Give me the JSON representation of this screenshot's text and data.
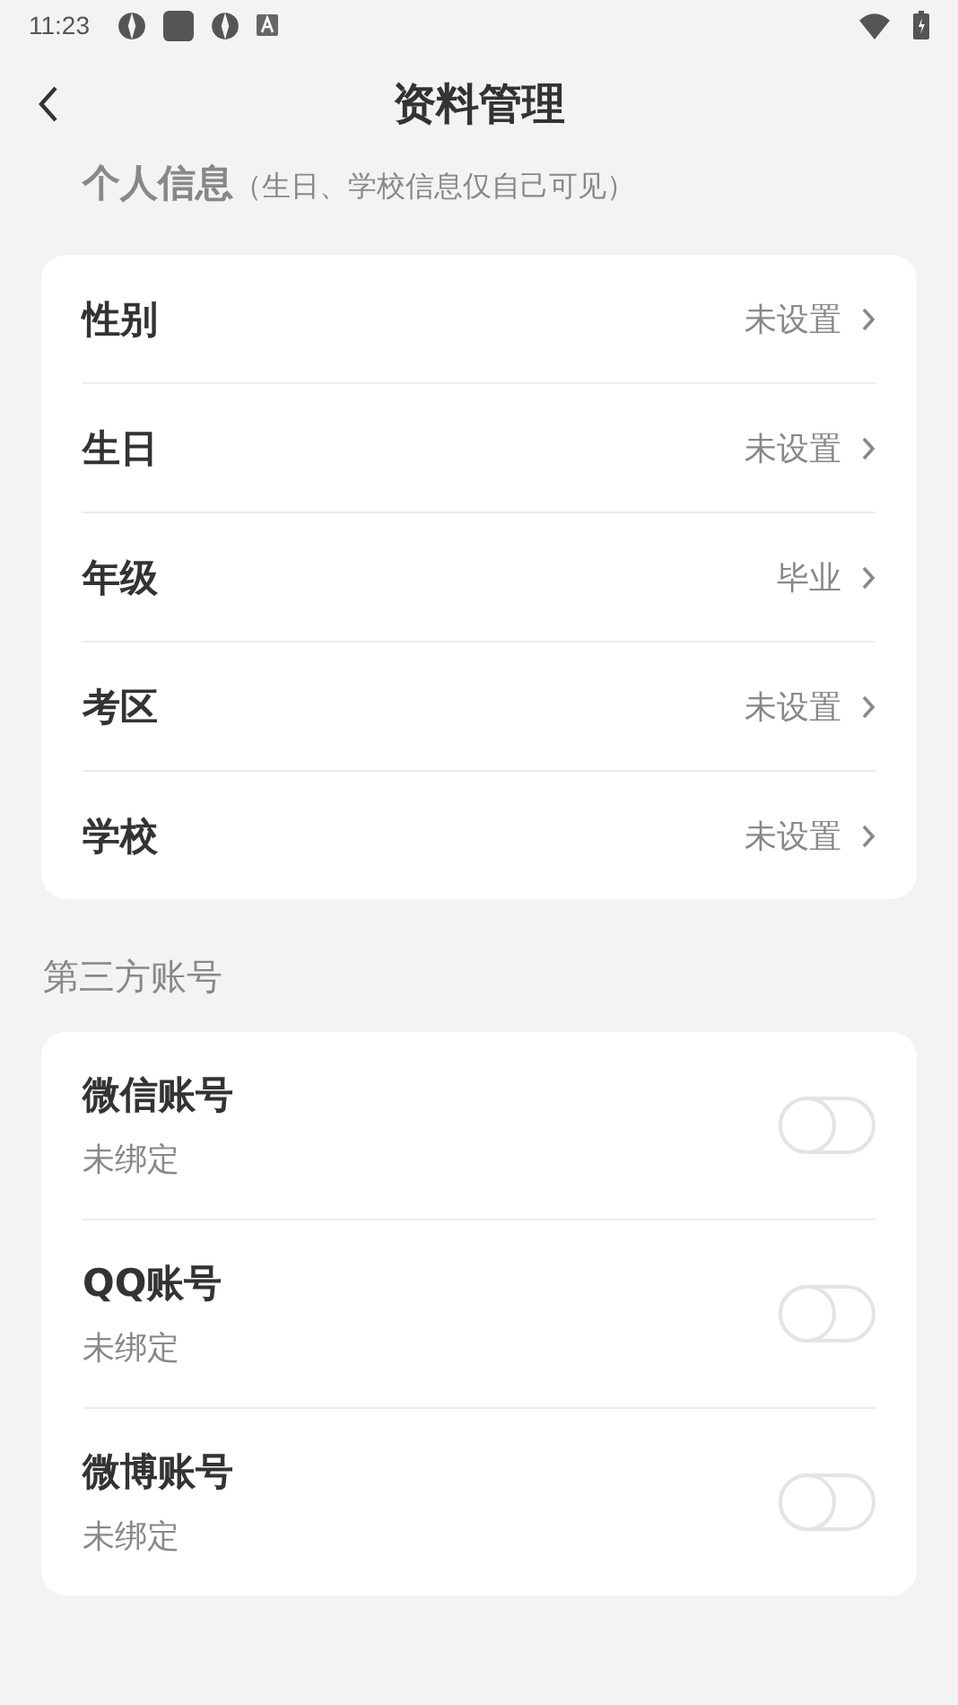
{
  "status_bar": {
    "time": "11:23"
  },
  "header": {
    "title": "资料管理"
  },
  "personal": {
    "title": "个人信息",
    "note": "（生日、学校信息仅自己可见）",
    "rows": [
      {
        "label": "性别",
        "value": "未设置"
      },
      {
        "label": "生日",
        "value": "未设置"
      },
      {
        "label": "年级",
        "value": "毕业"
      },
      {
        "label": "考区",
        "value": "未设置"
      },
      {
        "label": "学校",
        "value": "未设置"
      }
    ]
  },
  "accounts": {
    "title": "第三方账号",
    "rows": [
      {
        "label": "微信账号",
        "status": "未绑定",
        "on": false
      },
      {
        "label": "QQ账号",
        "status": "未绑定",
        "on": false
      },
      {
        "label": "微博账号",
        "status": "未绑定",
        "on": false
      }
    ]
  }
}
